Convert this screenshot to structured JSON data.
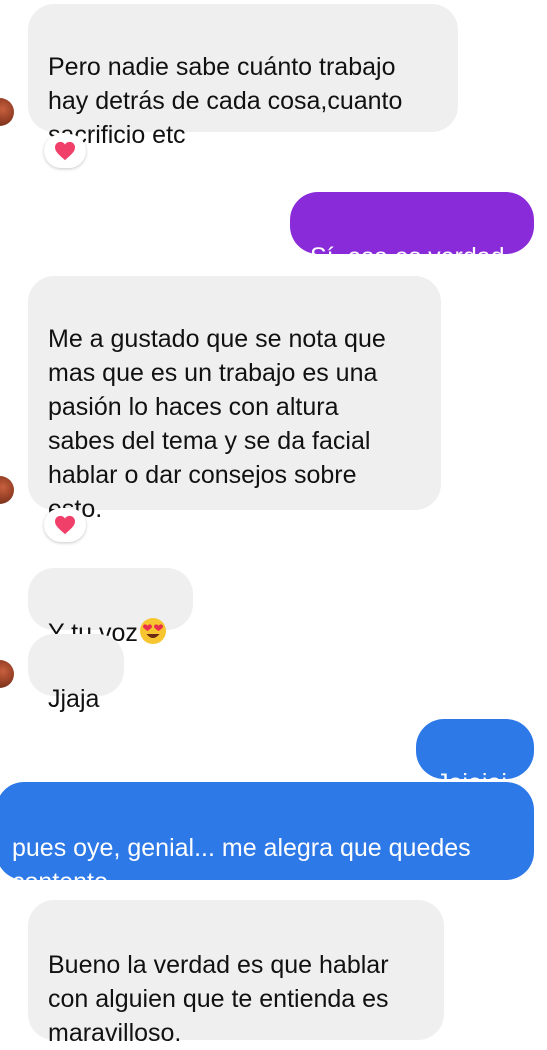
{
  "messages": [
    {
      "text": "Pero nadie sabe cuánto trabajo\nhay detrás de cada cosa,cuanto\nsacrificio etc",
      "reaction": "heart-icon"
    },
    {
      "text": "Sí, eso es verdad"
    },
    {
      "text": "Me a gustado que se nota que\nmas que es un trabajo es una\npasión lo haces con altura\nsabes del tema y se da facial\nhablar o dar consejos sobre\nesto.",
      "reaction": "heart-icon"
    },
    {
      "text": "Y tu voz",
      "emoji": "heart-eyes-emoji"
    },
    {
      "text": "Jjaja"
    },
    {
      "text": "Jajajaj"
    },
    {
      "text": "pues oye, genial... me alegra que quedes\ncontento"
    },
    {
      "text": "Bueno la verdad es que hablar\ncon alguien que te entienda es\nmaravilloso."
    }
  ],
  "colors": {
    "incoming_bubble": "#efefef",
    "outgoing_purple": "#8a2bd9",
    "outgoing_blue": "#2e79e8",
    "reaction_heart": "#f0406a"
  }
}
